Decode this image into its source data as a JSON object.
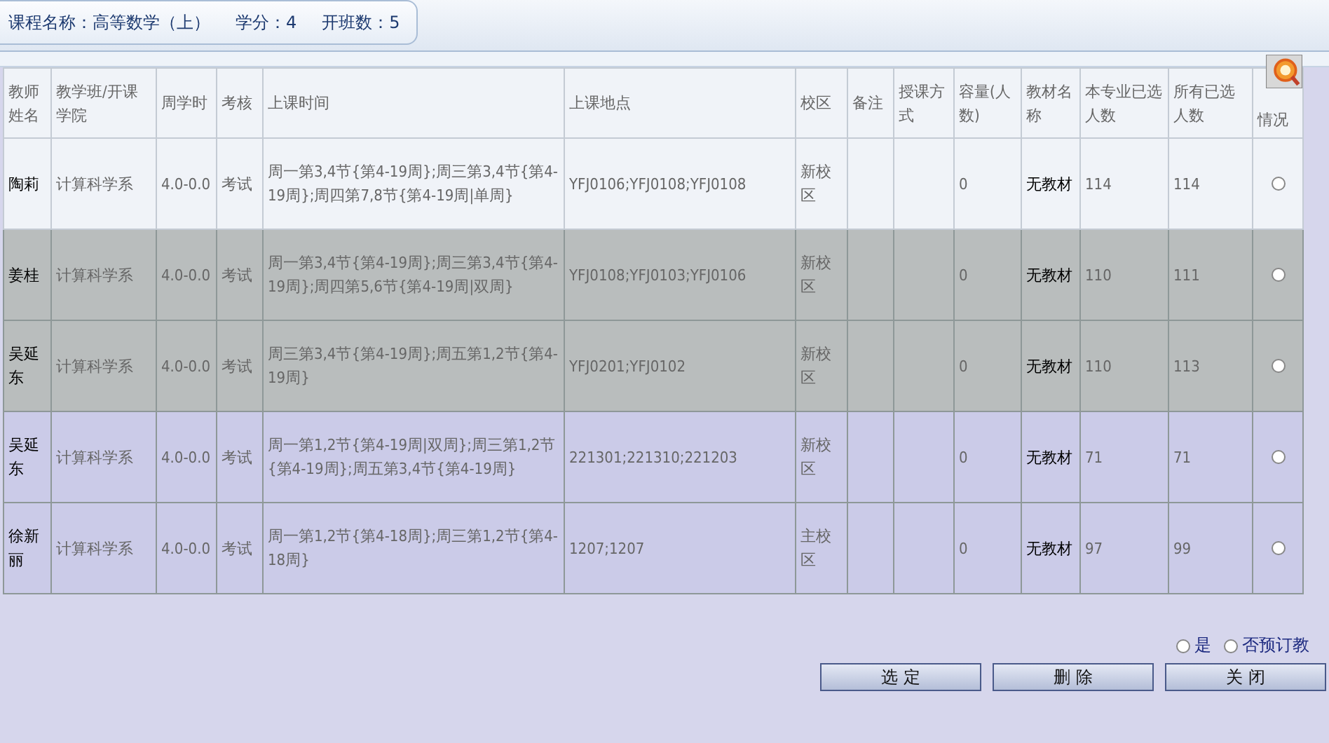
{
  "course_info": [
    "课程名称：高等数学（上）",
    "学分：4",
    "开班数：5"
  ],
  "table": {
    "columns": [
      "教师姓名",
      "教学班/开课学院",
      "周学时",
      "考核",
      "上课时间",
      "上课地点",
      "校区",
      "备注",
      "授课方式",
      "容量(人数)",
      "教材名称",
      "本专业已选人数",
      "所有已选人数",
      "情况"
    ],
    "rows": [
      {
        "cells": [
          "陶莉",
          "计算科学系",
          "4.0-0.0",
          "考试",
          "周一第3,4节{第4-19周};周三第3,4节{第4-19周};周四第7,8节{第4-19周|单周}",
          "YFJ0106;YFJ0108;YFJ0108",
          "新校区",
          "",
          "",
          "0",
          "无教材",
          "114",
          "114"
        ],
        "selected": false
      },
      {
        "cells": [
          "姜桂",
          "计算科学系",
          "4.0-0.0",
          "考试",
          "周一第3,4节{第4-19周};周三第3,4节{第4-19周};周四第5,6节{第4-19周|双周}",
          "YFJ0108;YFJ0103;YFJ0106",
          "新校区",
          "",
          "",
          "0",
          "无教材",
          "110",
          "111"
        ],
        "selected": false
      },
      {
        "cells": [
          "吴延东",
          "计算科学系",
          "4.0-0.0",
          "考试",
          "周三第3,4节{第4-19周};周五第1,2节{第4-19周}",
          "YFJ0201;YFJ0102",
          "新校区",
          "",
          "",
          "0",
          "无教材",
          "110",
          "113"
        ],
        "selected": false
      },
      {
        "cells": [
          "吴延东",
          "计算科学系",
          "4.0-0.0",
          "考试",
          "周一第1,2节{第4-19周|双周};周三第1,2节{第4-19周};周五第3,4节{第4-19周}",
          "221301;221310;221203",
          "新校区",
          "",
          "",
          "0",
          "无教材",
          "71",
          "71"
        ],
        "selected": false
      },
      {
        "cells": [
          "徐新丽",
          "计算科学系",
          "4.0-0.0",
          "考试",
          "周一第1,2节{第4-18周};周三第1,2节{第4-18周}",
          "1207;1207",
          "主校区",
          "",
          "",
          "0",
          "无教材",
          "97",
          "99"
        ],
        "selected": false
      }
    ]
  },
  "order_options": [
    {
      "label": "是",
      "selected": false
    },
    {
      "label": "否预订教",
      "selected": false
    }
  ],
  "buttons": [
    "选 定",
    "删 除",
    "关 闭"
  ]
}
